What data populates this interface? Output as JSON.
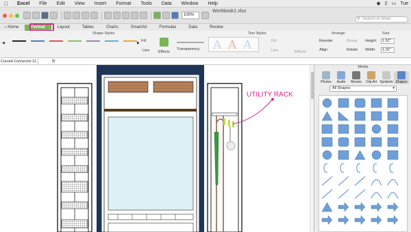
{
  "menubar": {
    "apple": "",
    "items": [
      "Excel",
      "File",
      "Edit",
      "View",
      "Insert",
      "Format",
      "Tools",
      "Data",
      "Window",
      "Help"
    ],
    "right_badge": "2",
    "clock": "Tue"
  },
  "toolbar": {
    "document_title": "Workbook1.xlsx",
    "zoom_value": "100%",
    "search_placeholder": "Search in Shee"
  },
  "ribbon_tabs": [
    "Home",
    "Format",
    "Layout",
    "Tables",
    "Charts",
    "SmartArt",
    "Formulas",
    "Data",
    "Review"
  ],
  "ribbon": {
    "shape_styles_title": "Shape Styles",
    "text_styles_title": "Text Styles",
    "arrange_title": "Arrange",
    "size_title": "Size",
    "fill_label": "Fill",
    "line_label": "Line",
    "effects_label": "Effects",
    "transparency_label": "Transparency",
    "text_fill_label": "Fill",
    "text_line_label": "Line",
    "text_effects_label": "Effects",
    "reorder_label": "Reorder",
    "group_label": "Group",
    "align_label": "Align",
    "rotate_label": "Rotate",
    "height_label": "Height:",
    "height_value": "1.52\"",
    "width_label": "Width:",
    "width_value": "1.02\"",
    "wordart_letter": "A"
  },
  "formula_bar": {
    "name_box": "Curved Connector 21",
    "fx_label": "fx"
  },
  "annotation": {
    "text": "UTILITY RACK",
    "color": "#e0208a"
  },
  "media_panel": {
    "title": "Media",
    "tabs": [
      "Photos",
      "Audio",
      "Movies",
      "Clip Art",
      "Symbols",
      "Shapes"
    ],
    "selected_category": "All Shapes"
  },
  "colors": {
    "accent": "#7ab35a",
    "highlight": "#e0208a",
    "frame_navy": "#1d3557",
    "shape_blue": "#6f9fd6"
  }
}
